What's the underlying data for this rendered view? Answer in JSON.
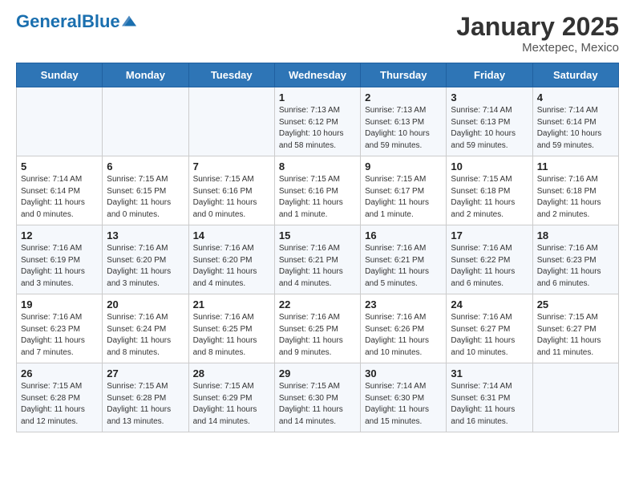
{
  "header": {
    "logo_general": "General",
    "logo_blue": "Blue",
    "title": "January 2025",
    "subtitle": "Mextepec, Mexico"
  },
  "weekdays": [
    "Sunday",
    "Monday",
    "Tuesday",
    "Wednesday",
    "Thursday",
    "Friday",
    "Saturday"
  ],
  "weeks": [
    [
      {
        "day": "",
        "info": ""
      },
      {
        "day": "",
        "info": ""
      },
      {
        "day": "",
        "info": ""
      },
      {
        "day": "1",
        "info": "Sunrise: 7:13 AM\nSunset: 6:12 PM\nDaylight: 10 hours\nand 58 minutes."
      },
      {
        "day": "2",
        "info": "Sunrise: 7:13 AM\nSunset: 6:13 PM\nDaylight: 10 hours\nand 59 minutes."
      },
      {
        "day": "3",
        "info": "Sunrise: 7:14 AM\nSunset: 6:13 PM\nDaylight: 10 hours\nand 59 minutes."
      },
      {
        "day": "4",
        "info": "Sunrise: 7:14 AM\nSunset: 6:14 PM\nDaylight: 10 hours\nand 59 minutes."
      }
    ],
    [
      {
        "day": "5",
        "info": "Sunrise: 7:14 AM\nSunset: 6:14 PM\nDaylight: 11 hours\nand 0 minutes."
      },
      {
        "day": "6",
        "info": "Sunrise: 7:15 AM\nSunset: 6:15 PM\nDaylight: 11 hours\nand 0 minutes."
      },
      {
        "day": "7",
        "info": "Sunrise: 7:15 AM\nSunset: 6:16 PM\nDaylight: 11 hours\nand 0 minutes."
      },
      {
        "day": "8",
        "info": "Sunrise: 7:15 AM\nSunset: 6:16 PM\nDaylight: 11 hours\nand 1 minute."
      },
      {
        "day": "9",
        "info": "Sunrise: 7:15 AM\nSunset: 6:17 PM\nDaylight: 11 hours\nand 1 minute."
      },
      {
        "day": "10",
        "info": "Sunrise: 7:15 AM\nSunset: 6:18 PM\nDaylight: 11 hours\nand 2 minutes."
      },
      {
        "day": "11",
        "info": "Sunrise: 7:16 AM\nSunset: 6:18 PM\nDaylight: 11 hours\nand 2 minutes."
      }
    ],
    [
      {
        "day": "12",
        "info": "Sunrise: 7:16 AM\nSunset: 6:19 PM\nDaylight: 11 hours\nand 3 minutes."
      },
      {
        "day": "13",
        "info": "Sunrise: 7:16 AM\nSunset: 6:20 PM\nDaylight: 11 hours\nand 3 minutes."
      },
      {
        "day": "14",
        "info": "Sunrise: 7:16 AM\nSunset: 6:20 PM\nDaylight: 11 hours\nand 4 minutes."
      },
      {
        "day": "15",
        "info": "Sunrise: 7:16 AM\nSunset: 6:21 PM\nDaylight: 11 hours\nand 4 minutes."
      },
      {
        "day": "16",
        "info": "Sunrise: 7:16 AM\nSunset: 6:21 PM\nDaylight: 11 hours\nand 5 minutes."
      },
      {
        "day": "17",
        "info": "Sunrise: 7:16 AM\nSunset: 6:22 PM\nDaylight: 11 hours\nand 6 minutes."
      },
      {
        "day": "18",
        "info": "Sunrise: 7:16 AM\nSunset: 6:23 PM\nDaylight: 11 hours\nand 6 minutes."
      }
    ],
    [
      {
        "day": "19",
        "info": "Sunrise: 7:16 AM\nSunset: 6:23 PM\nDaylight: 11 hours\nand 7 minutes."
      },
      {
        "day": "20",
        "info": "Sunrise: 7:16 AM\nSunset: 6:24 PM\nDaylight: 11 hours\nand 8 minutes."
      },
      {
        "day": "21",
        "info": "Sunrise: 7:16 AM\nSunset: 6:25 PM\nDaylight: 11 hours\nand 8 minutes."
      },
      {
        "day": "22",
        "info": "Sunrise: 7:16 AM\nSunset: 6:25 PM\nDaylight: 11 hours\nand 9 minutes."
      },
      {
        "day": "23",
        "info": "Sunrise: 7:16 AM\nSunset: 6:26 PM\nDaylight: 11 hours\nand 10 minutes."
      },
      {
        "day": "24",
        "info": "Sunrise: 7:16 AM\nSunset: 6:27 PM\nDaylight: 11 hours\nand 10 minutes."
      },
      {
        "day": "25",
        "info": "Sunrise: 7:15 AM\nSunset: 6:27 PM\nDaylight: 11 hours\nand 11 minutes."
      }
    ],
    [
      {
        "day": "26",
        "info": "Sunrise: 7:15 AM\nSunset: 6:28 PM\nDaylight: 11 hours\nand 12 minutes."
      },
      {
        "day": "27",
        "info": "Sunrise: 7:15 AM\nSunset: 6:28 PM\nDaylight: 11 hours\nand 13 minutes."
      },
      {
        "day": "28",
        "info": "Sunrise: 7:15 AM\nSunset: 6:29 PM\nDaylight: 11 hours\nand 14 minutes."
      },
      {
        "day": "29",
        "info": "Sunrise: 7:15 AM\nSunset: 6:30 PM\nDaylight: 11 hours\nand 14 minutes."
      },
      {
        "day": "30",
        "info": "Sunrise: 7:14 AM\nSunset: 6:30 PM\nDaylight: 11 hours\nand 15 minutes."
      },
      {
        "day": "31",
        "info": "Sunrise: 7:14 AM\nSunset: 6:31 PM\nDaylight: 11 hours\nand 16 minutes."
      },
      {
        "day": "",
        "info": ""
      }
    ]
  ]
}
